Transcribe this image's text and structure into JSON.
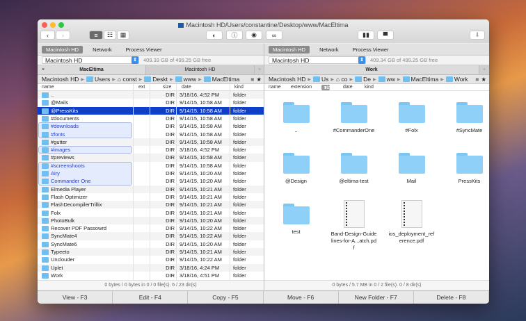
{
  "window": {
    "title": "Macintosh HD/Users/constantine/Desktop/www/MacEltima"
  },
  "drives": [
    "Macintosh HD",
    "Network",
    "Process Viewer"
  ],
  "left": {
    "disk": "Macintosh HD",
    "free": "409.33 GB of 499.25 GB free",
    "tabs": [
      "MacEltima",
      "Macintosh HD"
    ],
    "breadcrumb": [
      "Macintosh HD",
      "Users",
      "const",
      "Deskt",
      "www",
      "MacEltima"
    ],
    "columns": [
      "name",
      "ext",
      "size",
      "date",
      "kind"
    ],
    "rows": [
      [
        "..",
        "",
        "DIR",
        "3/18/16, 4:52 PM",
        "folder"
      ],
      [
        "@Mails",
        "",
        "DIR",
        "9/14/15, 10:58 AM",
        "folder"
      ],
      [
        "@PressKits",
        "",
        "DIR",
        "9/14/15, 10:58 AM",
        "folder"
      ],
      [
        "#documents",
        "",
        "DIR",
        "9/14/15, 10:58 AM",
        "folder"
      ],
      [
        "#downloads",
        "",
        "DIR",
        "9/14/15, 10:58 AM",
        "folder"
      ],
      [
        "#fonts",
        "",
        "DIR",
        "9/14/15, 10:58 AM",
        "folder"
      ],
      [
        "#gutter",
        "",
        "DIR",
        "9/14/15, 10:58 AM",
        "folder"
      ],
      [
        "#images",
        "",
        "DIR",
        "3/18/16, 4:52 PM",
        "folder"
      ],
      [
        "#previews",
        "",
        "DIR",
        "9/14/15, 10:58 AM",
        "folder"
      ],
      [
        "#screenshoots",
        "",
        "DIR",
        "9/14/15, 10:58 AM",
        "folder"
      ],
      [
        "Airy",
        "",
        "DIR",
        "9/14/15, 10:20 AM",
        "folder"
      ],
      [
        "Commander One",
        "",
        "DIR",
        "9/14/15, 10:20 AM",
        "folder"
      ],
      [
        "Elmedia Player",
        "",
        "DIR",
        "9/14/15, 10:21 AM",
        "folder"
      ],
      [
        "Flash Optimizer",
        "",
        "DIR",
        "9/14/15, 10:21 AM",
        "folder"
      ],
      [
        "FlashDecompilerTrillix",
        "",
        "DIR",
        "9/14/15, 10:21 AM",
        "folder"
      ],
      [
        "Folx",
        "",
        "DIR",
        "9/14/15, 10:21 AM",
        "folder"
      ],
      [
        "PhotoBulk",
        "",
        "DIR",
        "9/14/15, 10:20 AM",
        "folder"
      ],
      [
        "Recover PDF Passowrd",
        "",
        "DIR",
        "9/14/15, 10:22 AM",
        "folder"
      ],
      [
        "SyncMate4",
        "",
        "DIR",
        "9/14/15, 10:22 AM",
        "folder"
      ],
      [
        "SyncMate6",
        "",
        "DIR",
        "9/14/15, 10:20 AM",
        "folder"
      ],
      [
        "Typeeto",
        "",
        "DIR",
        "9/14/15, 10:21 AM",
        "folder"
      ],
      [
        "Unclouder",
        "",
        "DIR",
        "9/14/15, 10:22 AM",
        "folder"
      ],
      [
        "Uplet",
        "",
        "DIR",
        "3/18/16, 4:24 PM",
        "folder"
      ],
      [
        "Work",
        "",
        "DIR",
        "3/18/16, 4:51 PM",
        "folder"
      ]
    ],
    "selected_index": 2,
    "marked_indices": [
      4,
      5,
      7,
      9,
      10,
      11
    ],
    "status": "0 bytes / 0 bytes in 0 / 0 file(s). 6 / 23 dir(s)"
  },
  "right": {
    "disk": "Macintosh HD",
    "free": "409.34 GB of 499.25 GB free",
    "tabs": [
      "Work"
    ],
    "breadcrumb": [
      "Macintosh HD",
      "Us",
      "co",
      "De",
      "ww",
      "MacEltima",
      "Work"
    ],
    "columns": [
      "name",
      "extension",
      "size",
      "date",
      "kind"
    ],
    "items": [
      {
        "name": "..",
        "type": "folder"
      },
      {
        "name": "#CommanderOne",
        "type": "folder"
      },
      {
        "name": "#Folx",
        "type": "folder"
      },
      {
        "name": "#SyncMate",
        "type": "folder"
      },
      {
        "name": "@Design",
        "type": "folder"
      },
      {
        "name": "@eltima-test",
        "type": "folder"
      },
      {
        "name": "Mail",
        "type": "folder"
      },
      {
        "name": "PressKits",
        "type": "folder"
      },
      {
        "name": "test",
        "type": "folder"
      },
      {
        "name": "Band-Design-Guidelines-for-A...atch.pdf",
        "type": "pdf"
      },
      {
        "name": "ios_deployment_reference.pdf",
        "type": "pdf"
      }
    ],
    "status": "0 bytes / 5.7 MB in 0 / 2 file(s). 0 / 8 dir(s)"
  },
  "fkeys": [
    "View - F3",
    "Edit - F4",
    "Copy - F5",
    "Move - F6",
    "New Folder - F7",
    "Delete - F8"
  ]
}
